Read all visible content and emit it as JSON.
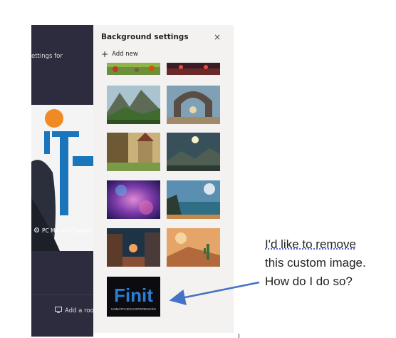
{
  "app": {
    "settings_for_text": "ettings for",
    "device_label": "PC Mic and Speakers",
    "add_room_label": "Add a room"
  },
  "panel": {
    "title": "Background settings",
    "close_glyph": "×",
    "add_new_label": "Add new",
    "add_new_glyph": "+"
  },
  "annotation": {
    "lines": [
      "I'd like to remove",
      "this custom image.",
      "How do I do so?"
    ],
    "arrow_color": "#4472c4"
  },
  "custom_image": {
    "brand": "Finit",
    "tagline": "UNMATCHED EXPERIENCES"
  },
  "colors": {
    "app_bg": "#2d2c3e",
    "panel_bg": "#f3f2f1",
    "accent_orange": "#f08a24",
    "accent_blue": "#1b75bb"
  }
}
